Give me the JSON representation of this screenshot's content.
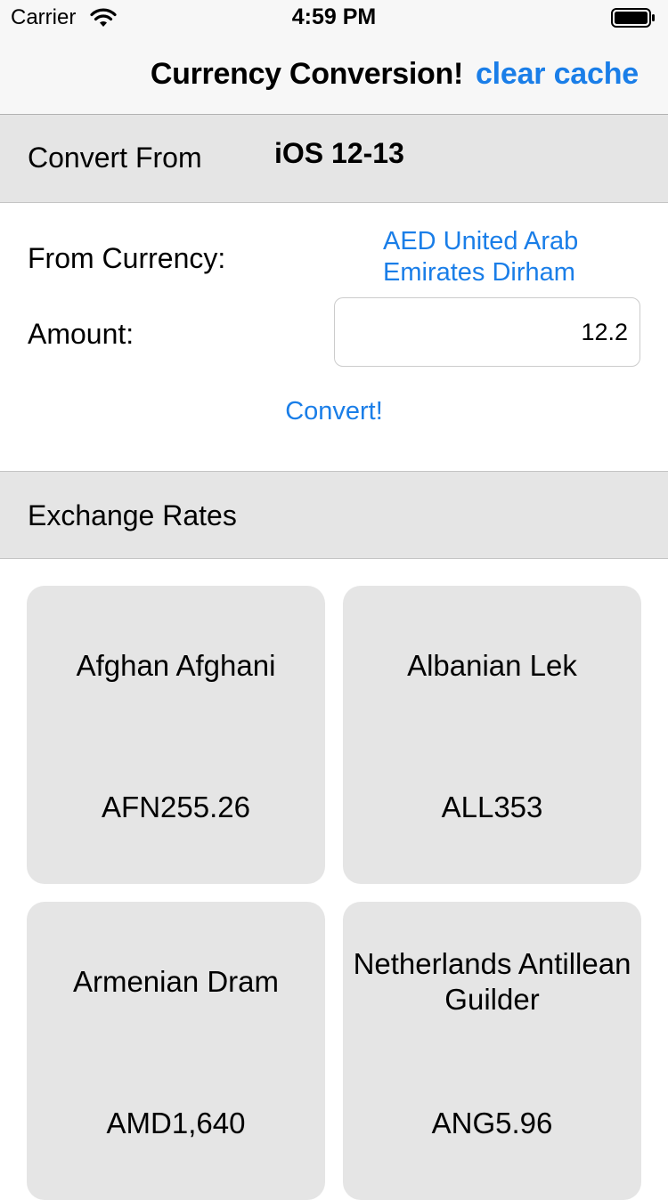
{
  "status_bar": {
    "carrier": "Carrier",
    "time": "4:59 PM"
  },
  "nav": {
    "title": "Currency Conversion!",
    "clear_label": "clear cache"
  },
  "convert_section": {
    "header_label": "Convert From",
    "header_sub": "iOS 12-13"
  },
  "form": {
    "from_label": "From Currency:",
    "from_value": "AED United Arab Emirates Dirham",
    "amount_label": "Amount:",
    "amount_value": "12.2",
    "convert_label": "Convert!"
  },
  "rates_section": {
    "header_label": "Exchange Rates"
  },
  "rates": [
    {
      "name": "Afghan Afghani",
      "value": "AFN255.26"
    },
    {
      "name": "Albanian Lek",
      "value": "ALL353"
    },
    {
      "name": "Armenian Dram",
      "value": "AMD1,640"
    },
    {
      "name": "Netherlands Antillean Guilder",
      "value": "ANG5.96"
    }
  ],
  "colors": {
    "accent": "#1a7ee8",
    "section_bg": "#e5e5e5",
    "bar_bg": "#f7f7f7"
  },
  "icons": {
    "wifi": "wifi-icon",
    "battery": "battery-icon"
  }
}
